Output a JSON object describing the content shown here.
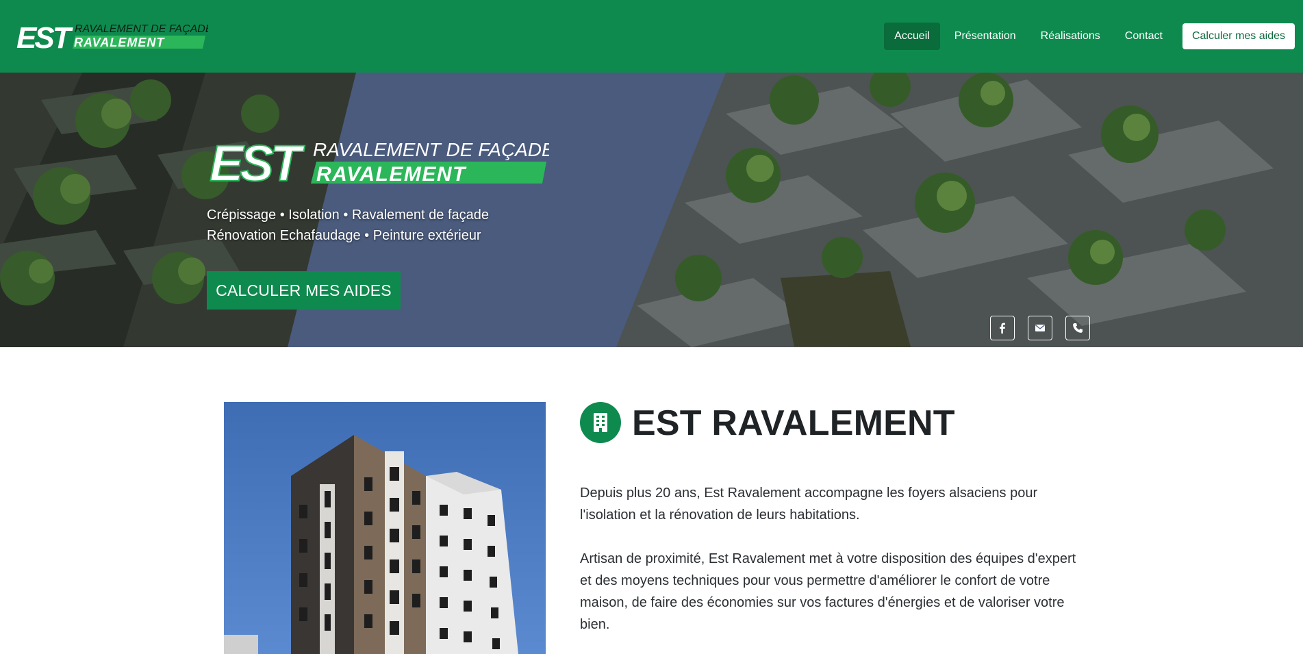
{
  "brand": {
    "logo_letters": "EST",
    "logo_line1": "RAVALEMENT DE FAÇADES",
    "logo_line2": "RAVALEMENT"
  },
  "nav": {
    "items": [
      {
        "label": "Accueil",
        "active": true
      },
      {
        "label": "Présentation",
        "active": false
      },
      {
        "label": "Réalisations",
        "active": false
      },
      {
        "label": "Contact",
        "active": false
      }
    ],
    "cta_label": "Calculer mes aides"
  },
  "hero": {
    "tagline_line1": "Crépissage • Isolation • Ravalement de façade",
    "tagline_line2": "Rénovation Echafaudage • Peinture extérieur",
    "cta_label": "CALCULER MES AIDES",
    "social_icons": [
      "facebook-icon",
      "envelope-icon",
      "phone-icon"
    ]
  },
  "about": {
    "title": "EST RAVALEMENT",
    "title_icon": "building-icon",
    "paragraph1": "Depuis plus 20 ans, Est Ravalement accompagne les foyers alsaciens pour l'isolation et la rénovation de leurs habitations.",
    "paragraph2": "Artisan de proximité, Est Ravalement met à votre disposition des équipes d'expert et des moyens techniques pour vous permettre d'améliorer le confort de votre maison, de faire des économies sur vos factures d'énergies et de valoriser votre bien."
  },
  "colors": {
    "brand_green": "#0f8a4e",
    "brand_green_dark": "#0a6b3b",
    "logo_light_green": "#2cb65a",
    "text_dark": "#1f2326"
  }
}
